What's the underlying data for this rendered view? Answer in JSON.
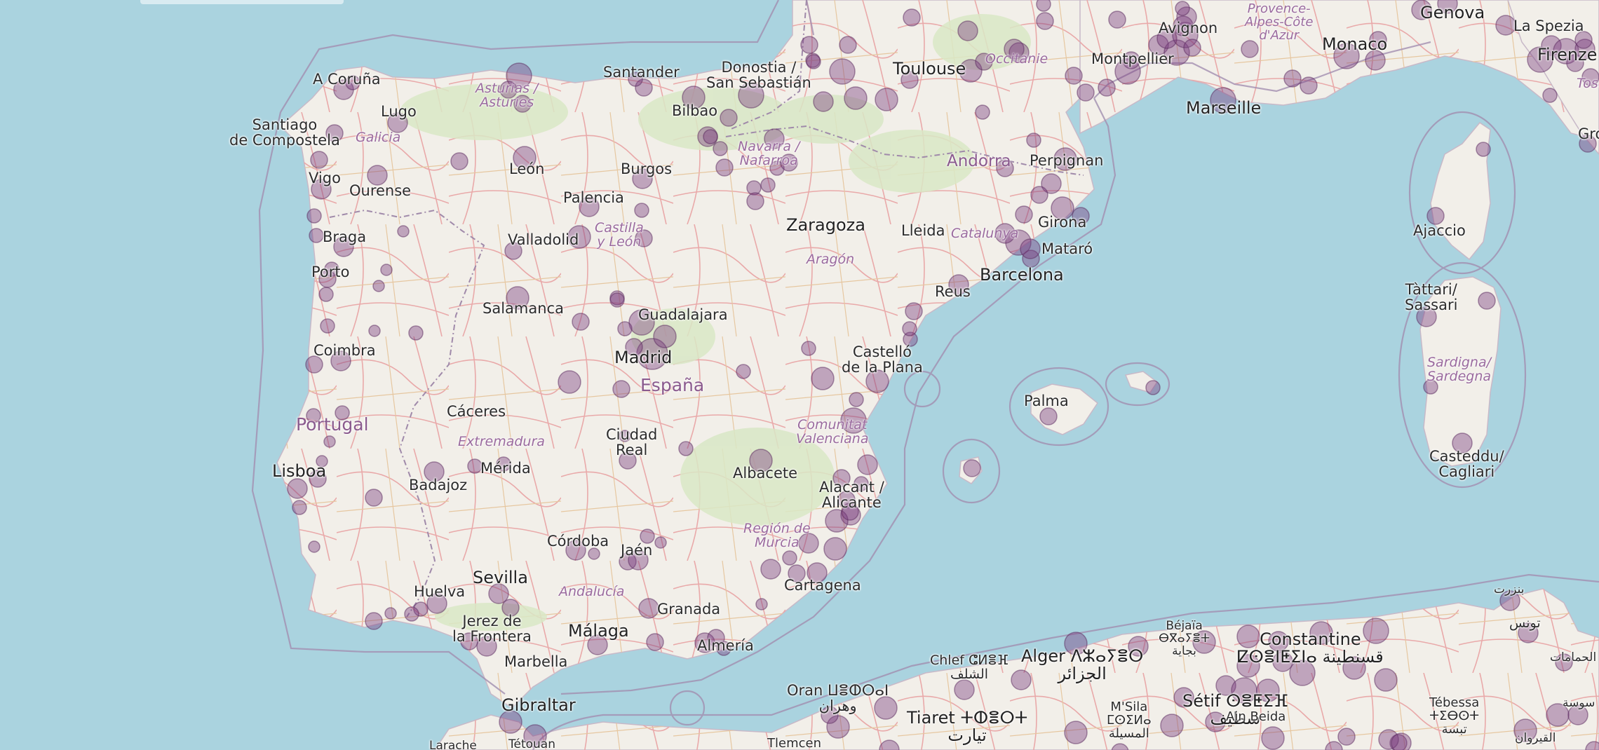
{
  "map": {
    "colors": {
      "sea": "#aad3df",
      "land": "#f2efe9",
      "green": "#d8e8c4",
      "road": "#e8a4a4",
      "boundary": "#9a86a8",
      "marker_fill": "#7a3c7e",
      "marker_stroke": "#5a2a5e"
    },
    "countries": [
      {
        "name": "España"
      },
      {
        "name": "Portugal"
      },
      {
        "name": "Andorra"
      }
    ],
    "regions": [
      {
        "name": "Galicia"
      },
      {
        "name": "Asturias /\nAsturies"
      },
      {
        "name": "Castilla\ny León"
      },
      {
        "name": "Navarra /\nNafarroa"
      },
      {
        "name": "Aragón"
      },
      {
        "name": "Catalunya"
      },
      {
        "name": "Comunitat\nValenciana"
      },
      {
        "name": "Extremadura"
      },
      {
        "name": "Andalucía"
      },
      {
        "name": "Región de\nMurcia"
      },
      {
        "name": "Occitanie"
      },
      {
        "name": "Provence-\nAlpes-Côte\nd'Azur"
      },
      {
        "name": "Sardigna/\nSardegna"
      }
    ],
    "cities": [
      {
        "name": "A Coruña"
      },
      {
        "name": "Lugo"
      },
      {
        "name": "Santiago\nde Compostela"
      },
      {
        "name": "Vigo"
      },
      {
        "name": "Ourense"
      },
      {
        "name": "Braga"
      },
      {
        "name": "Porto"
      },
      {
        "name": "Coimbra"
      },
      {
        "name": "Lisboa"
      },
      {
        "name": "Santander"
      },
      {
        "name": "Donostia /\nSan Sebastián"
      },
      {
        "name": "Bilbao"
      },
      {
        "name": "León"
      },
      {
        "name": "Burgos"
      },
      {
        "name": "Palencia"
      },
      {
        "name": "Valladolid"
      },
      {
        "name": "Salamanca"
      },
      {
        "name": "Guadalajara"
      },
      {
        "name": "Madrid"
      },
      {
        "name": "Cáceres"
      },
      {
        "name": "Badajoz"
      },
      {
        "name": "Mérida"
      },
      {
        "name": "Ciudad\nReal"
      },
      {
        "name": "Albacete"
      },
      {
        "name": "Zaragoza"
      },
      {
        "name": "Lleida"
      },
      {
        "name": "Girona"
      },
      {
        "name": "Mataró"
      },
      {
        "name": "Barcelona"
      },
      {
        "name": "Reus"
      },
      {
        "name": "Castelló\nde la Plana"
      },
      {
        "name": "Alacant /\nAlicante"
      },
      {
        "name": "Cartagena"
      },
      {
        "name": "Córdoba"
      },
      {
        "name": "Jaén"
      },
      {
        "name": "Sevilla"
      },
      {
        "name": "Huelva"
      },
      {
        "name": "Granada"
      },
      {
        "name": "Jerez de\nla Frontera"
      },
      {
        "name": "Málaga"
      },
      {
        "name": "Almería"
      },
      {
        "name": "Marbella"
      },
      {
        "name": "Gibraltar"
      },
      {
        "name": "Palma"
      },
      {
        "name": "Toulouse"
      },
      {
        "name": "Montpellier"
      },
      {
        "name": "Avignon"
      },
      {
        "name": "Marseille"
      },
      {
        "name": "Monaco"
      },
      {
        "name": "Genova"
      },
      {
        "name": "La Spezia"
      },
      {
        "name": "Firenze"
      },
      {
        "name": "Perpignan"
      },
      {
        "name": "Ajaccio"
      },
      {
        "name": "Tàttari/\nSassari"
      },
      {
        "name": "Casteddu/\nCagliari"
      },
      {
        "name": "Oran ⵡⴻⵀⵔⴰⵏ\nوهران"
      },
      {
        "name": "Chlef ⵛⵍⴻⴼ\nالشلف"
      },
      {
        "name": "Alger ⴷⵣⴰⵢⴻⵔ\nالجزائر"
      },
      {
        "name": "Béjaïa\nⴱⴳⴰⵢⴻⵜ\nبجاية"
      },
      {
        "name": "Constantine\nⵇⵙⴻⵏⵟⵉⵏⴰ قسنطينة"
      },
      {
        "name": "Sétif ⵙⴻⵟⵉⴼ\nسطيف"
      },
      {
        "name": "Tiaret ⵜⵀⴻⵔⵜ\nتيارت"
      },
      {
        "name": "M'Sila\nⵎⵙⵉⵍⴰ\nالمسيلة"
      },
      {
        "name": "Ain Beida"
      },
      {
        "name": "Tébessa\nⵜⵉⴱⵙⵜ\nتبسة"
      },
      {
        "name": "Tlemcen"
      },
      {
        "name": "Tétouan"
      },
      {
        "name": "Larache"
      },
      {
        "name": "بنزرت"
      },
      {
        "name": "تونس"
      },
      {
        "name": "الحمامات"
      },
      {
        "name": "سوسة"
      },
      {
        "name": "القيروان"
      },
      {
        "name": "Gross"
      },
      {
        "name": "Tosc"
      }
    ],
    "marker_count": 240
  }
}
